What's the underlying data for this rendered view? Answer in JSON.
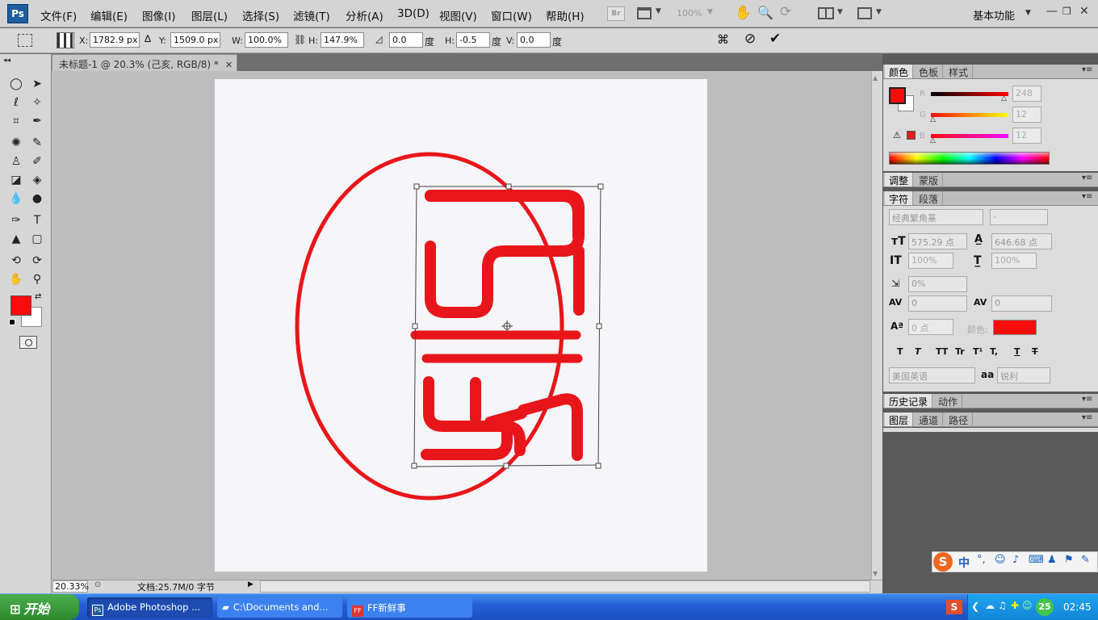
{
  "app": {
    "logo": "Ps",
    "name": "Adobe Photoshop"
  },
  "menu": [
    "文件(F)",
    "编辑(E)",
    "图像(I)",
    "图层(L)",
    "选择(S)",
    "滤镜(T)",
    "分析(A)",
    "3D(D)",
    "视图(V)",
    "窗口(W)",
    "帮助(H)"
  ],
  "topbar": {
    "br_label": "Br",
    "zoom": "100%",
    "workspace": "基本功能"
  },
  "options": {
    "x_label": "X:",
    "x": "1782.9 px",
    "y_label": "Y:",
    "y": "1509.0 px",
    "w_label": "W:",
    "w": "100.0%",
    "h_label": "H:",
    "h": "147.9%",
    "angle": "0.0",
    "angle_unit": "度",
    "hskew_label": "H:",
    "hskew": "-0.5",
    "hskew_unit": "度",
    "vskew_label": "V:",
    "vskew": "0.0",
    "vskew_unit": "度"
  },
  "document": {
    "tab_title": "未标题-1 @ 20.3% (己亥, RGB/8) *",
    "zoom": "20.33%",
    "doc_info": "文档:25.7M/0 字节"
  },
  "colors": {
    "foreground": "#F80C0C",
    "background": "#FFFFFF",
    "seal_red": "#E8161A",
    "canvas_bg": "#F6F5F8"
  },
  "color_panel": {
    "tabs": [
      "颜色",
      "色板",
      "样式"
    ],
    "r_label": "R",
    "r": "248",
    "g_label": "G",
    "g": "12",
    "b_label": "B",
    "b": "12"
  },
  "adjust_panel": {
    "tabs": [
      "调整",
      "蒙版"
    ]
  },
  "char_panel": {
    "tabs": [
      "字符",
      "段落"
    ],
    "font": "经典繁角篆",
    "style": "-",
    "size": "575.29 点",
    "leading": "646.68 点",
    "vscale": "100%",
    "hscale": "100%",
    "tsume": "0%",
    "kerning": "0",
    "tracking": "0",
    "baseline": "0 点",
    "color_label": "颜色:",
    "styles": [
      "T",
      "T",
      "TT",
      "Tr",
      "T¹",
      "T,",
      "T",
      "T"
    ],
    "language": "美国英语",
    "aa_label": "aa",
    "aa": "锐利"
  },
  "history_panel": {
    "tabs": [
      "历史记录",
      "动作"
    ]
  },
  "layers_panel": {
    "tabs": [
      "图层",
      "通道",
      "路径"
    ]
  },
  "ime": {
    "mode": "中"
  },
  "taskbar": {
    "start": "开始",
    "tasks": [
      "Adobe Photoshop ...",
      "C:\\Documents and...",
      "FF新鲜事"
    ],
    "tray_badge": "25",
    "time": "02:45"
  }
}
